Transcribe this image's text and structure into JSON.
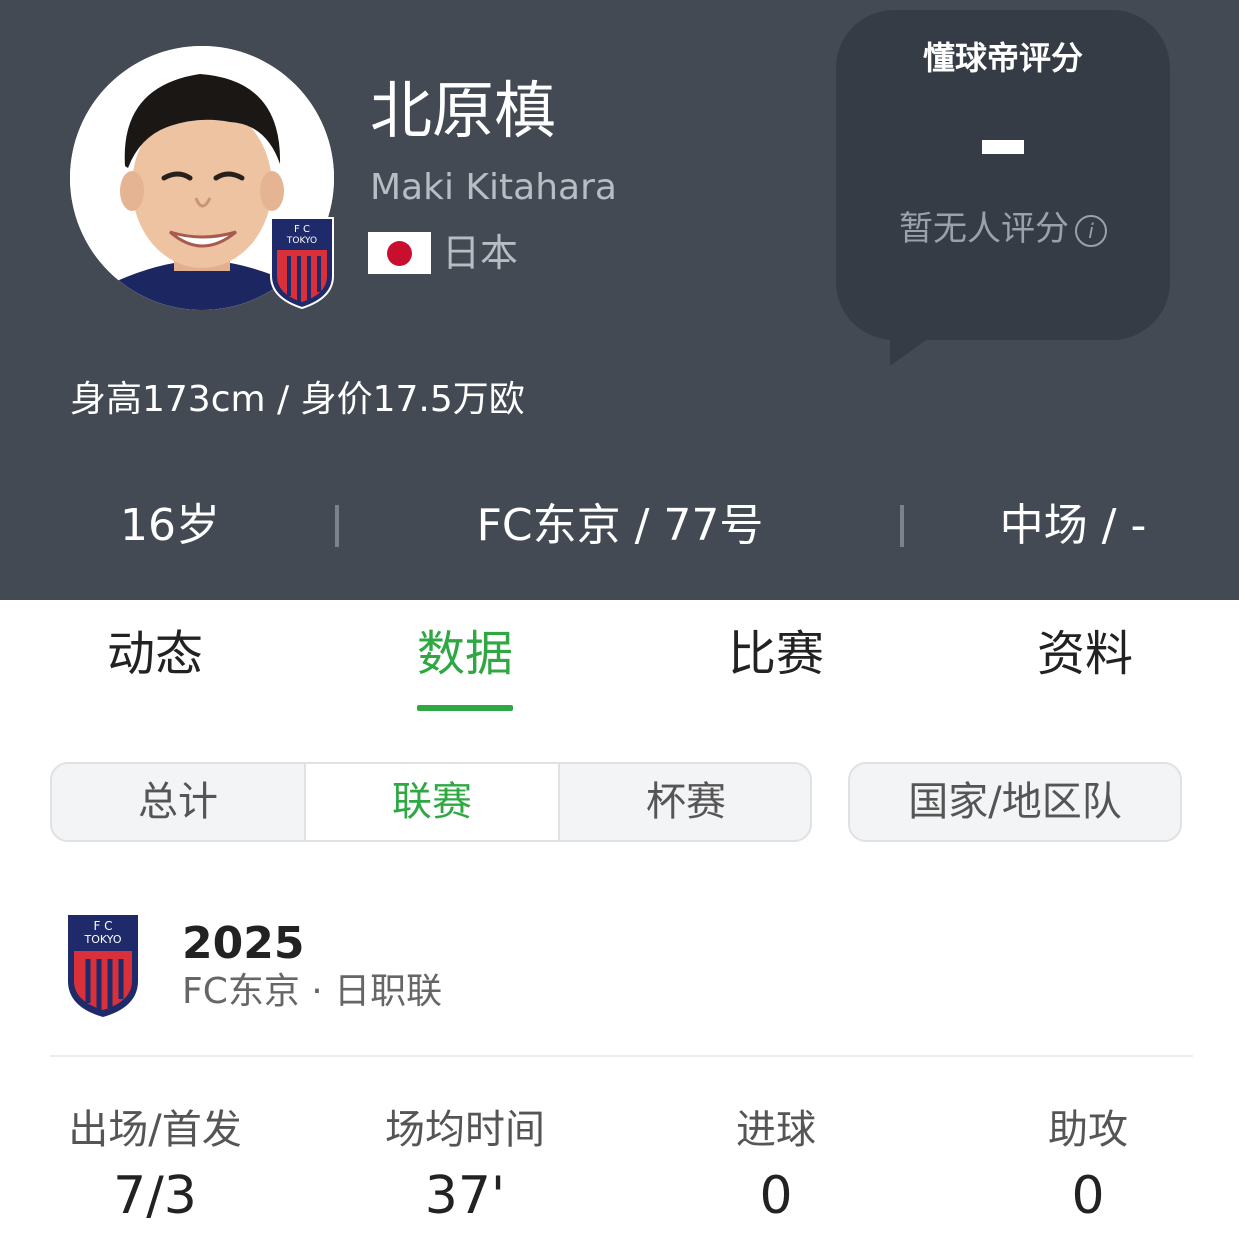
{
  "player": {
    "name_cn": "北原槙",
    "name_en": "Maki Kitahara",
    "nationality": "日本",
    "height_value": "身高173cm / 身价17.5万欧",
    "age": "16岁",
    "club_number": "FC东京 / 77号",
    "position": "中场 / -"
  },
  "badge": {
    "fc": "F   C",
    "tokyo": "TOKYO"
  },
  "rating": {
    "title": "懂球帝评分",
    "note": "暂无人评分",
    "info_glyph": "i"
  },
  "tabs": [
    {
      "label": "动态",
      "active": false
    },
    {
      "label": "数据",
      "active": true
    },
    {
      "label": "比赛",
      "active": false
    },
    {
      "label": "资料",
      "active": false
    }
  ],
  "segments": [
    {
      "label": "总计",
      "active": false
    },
    {
      "label": "联赛",
      "active": true
    },
    {
      "label": "杯赛",
      "active": false
    }
  ],
  "national_team_button": "国家/地区队",
  "season": {
    "year": "2025",
    "subtitle": "FC东京 · 日职联"
  },
  "stats": [
    {
      "label": "出场/首发",
      "value": "7/3"
    },
    {
      "label": "场均时间",
      "value": "37'"
    },
    {
      "label": "进球",
      "value": "0"
    },
    {
      "label": "助攻",
      "value": "0"
    }
  ],
  "colors": {
    "header_bg": "#434a53",
    "accent_green": "#2fa844",
    "club_navy": "#1f2a6b",
    "club_red": "#d9303a"
  }
}
